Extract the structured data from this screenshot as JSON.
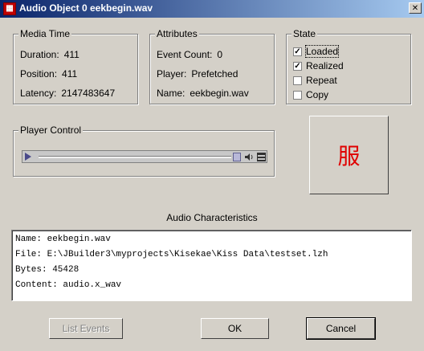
{
  "window": {
    "title": "Audio Object 0 eekbegin.wav",
    "close_glyph": "✕"
  },
  "media_time": {
    "legend": "Media Time",
    "duration_label": "Duration:",
    "duration": "411",
    "position_label": "Position:",
    "position": "411",
    "latency_label": "Latency:",
    "latency": "2147483647"
  },
  "attributes": {
    "legend": "Attributes",
    "event_count_label": "Event Count:",
    "event_count": "0",
    "player_label": "Player:",
    "player": "Prefetched",
    "name_label": "Name:",
    "name": "eekbegin.wav"
  },
  "state": {
    "legend": "State",
    "items": [
      {
        "label": "Loaded",
        "checked": true
      },
      {
        "label": "Realized",
        "checked": true
      },
      {
        "label": "Repeat",
        "checked": false
      },
      {
        "label": "Copy",
        "checked": false
      }
    ]
  },
  "player_control": {
    "legend": "Player Control",
    "position_fraction": 1.0
  },
  "visual_panel": {
    "glyph": "服"
  },
  "audio_characteristics": {
    "label": "Audio Characteristics",
    "lines": [
      "Name: eekbegin.wav",
      "File: E:\\JBuilder3\\myprojects\\Kisekae\\Kiss Data\\testset.lzh",
      "Bytes: 45428",
      "Content: audio.x_wav"
    ]
  },
  "buttons": {
    "list_events": "List Events",
    "ok": "OK",
    "cancel": "Cancel"
  },
  "colors": {
    "title_bar": "#0a246a",
    "glyph": "#e00000",
    "face": "#d4d0c8"
  }
}
